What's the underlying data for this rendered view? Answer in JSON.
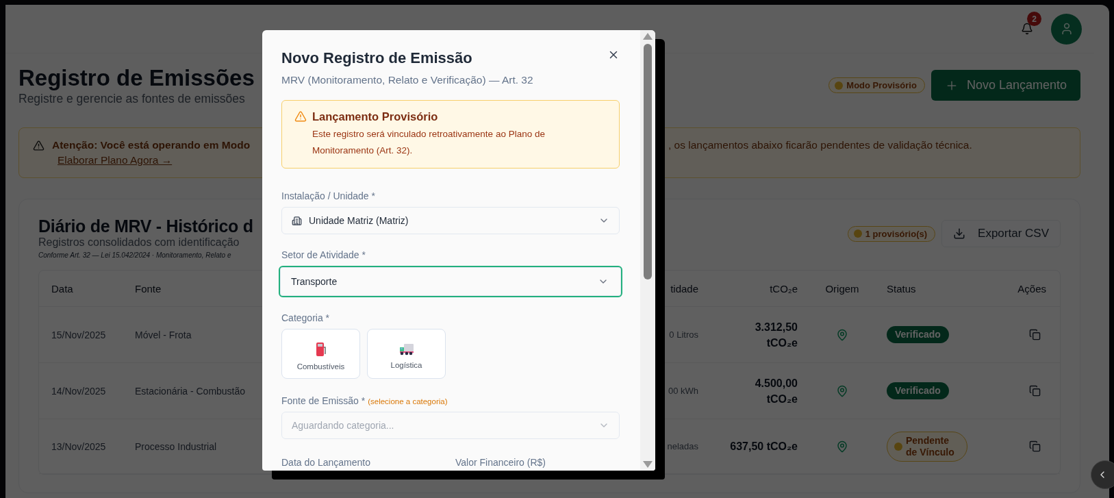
{
  "header": {
    "notification_count": "2"
  },
  "page": {
    "title": "Registro de Emissões",
    "subtitle": "Registre e gerencie as fontes de emissões",
    "mode_badge": "Modo Provisório",
    "new_button": "Novo Lançamento"
  },
  "alert": {
    "text": "Atenção: Você está operando em Modo",
    "text_continued": ", os lançamentos abaixo ficarão pendentes de validação técnica.",
    "link": "Elaborar Plano Agora →"
  },
  "journal": {
    "title": "Diário de MRV - Histórico d",
    "subtitle": "Registros consolidados com identificação",
    "note": "Conforme Art. 32 — Lei 15.042/2024 · Monitoramento, Relato e",
    "badge": "1 provisório(s)",
    "export_button": "Exportar CSV",
    "columns": [
      "Data",
      "Fonte",
      "tidade",
      "tCO₂e",
      "Origem",
      "Status",
      "Ações"
    ],
    "rows": [
      {
        "date": "15/Nov/2025",
        "source": "Móvel - Frota",
        "quantity": "0 Litros",
        "emissions": "3.312,50 tCO₂e",
        "status": {
          "kind": "verified",
          "label": "Verificado"
        }
      },
      {
        "date": "14/Nov/2025",
        "source": "Estacionária - Combustão",
        "quantity": "00 kWh",
        "emissions": "4.500,00 tCO₂e",
        "status": {
          "kind": "verified",
          "label": "Verificado"
        }
      },
      {
        "date": "13/Nov/2025",
        "source": "Processo Industrial",
        "quantity": "neladas",
        "emissions": "637,50 tCO₂e",
        "status": {
          "kind": "pending",
          "label": "Pendente de Vínculo"
        }
      }
    ]
  },
  "modal": {
    "title": "Novo Registro de Emissão",
    "subtitle": "MRV (Monitoramento, Relato e Verificação) — Art. 32",
    "notice": {
      "title": "Lançamento Provisório",
      "text": "Este registro será vinculado retroativamente ao Plano de Monitoramento (Art. 32)."
    },
    "fields": [
      {
        "kind": "facility",
        "label": "Instalação / Unidade *",
        "value": "Unidade Matriz (Matriz)",
        "focused": false,
        "disabled": false
      },
      {
        "kind": "select",
        "label": "Setor de Atividade *",
        "value": "Transporte",
        "focused": true,
        "disabled": false
      }
    ],
    "category_label": "Categoria *",
    "categories": [
      {
        "kind": "fuel",
        "label": "Combustíveis",
        "selected": false
      },
      {
        "kind": "truck",
        "label": "Logística",
        "selected": false
      }
    ],
    "source_field": {
      "label": "Fonte de Emissão *",
      "hint": "(selecione a categoria)",
      "placeholder": "Aguardando categoria...",
      "disabled": true
    },
    "bottom_labels": [
      "Data do Lançamento",
      "Valor Financeiro (R$)"
    ]
  }
}
